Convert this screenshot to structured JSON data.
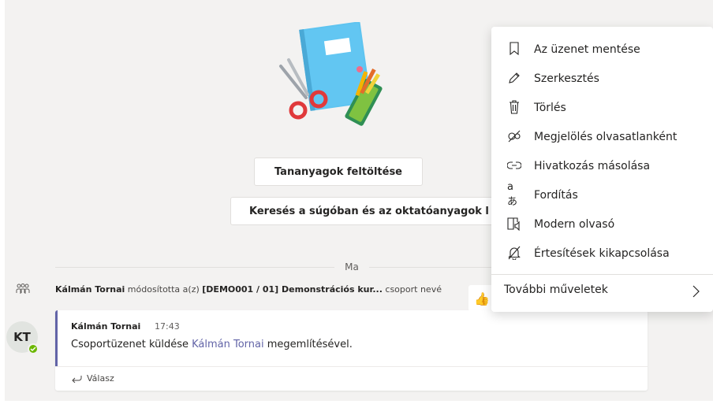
{
  "onboarding": {
    "upload_button": "Tananyagok feltöltése",
    "search_button": "Keresés a súgóban és az oktatóanyagok l"
  },
  "feed": {
    "date_divider": "Ma",
    "system_message": {
      "actor": "Kálmán Tornai",
      "text": " módosította a(z) ",
      "target": "[DEMO001 / 01] Demonstrációs kur...",
      "suffix": " csoport nevé"
    },
    "message": {
      "avatar_initials": "KT",
      "author": "Kálmán Tornai",
      "time": "17:43",
      "body_prefix": "Csoportüzenet küldése ",
      "mention": "Kálmán Tornai",
      "body_suffix": " megemlítésével.",
      "reply_label": "Válasz"
    },
    "reaction_emoji": "👍"
  },
  "context_menu": {
    "items": [
      {
        "label": "Az üzenet mentése",
        "icon": "bookmark-icon"
      },
      {
        "label": "Szerkesztés",
        "icon": "pencil-icon"
      },
      {
        "label": "Törlés",
        "icon": "trash-icon"
      },
      {
        "label": "Megjelölés olvasatlanként",
        "icon": "unread-icon"
      },
      {
        "label": "Hivatkozás másolása",
        "icon": "link-icon"
      },
      {
        "label": "Fordítás",
        "icon": "translate-icon"
      },
      {
        "label": "Modern olvasó",
        "icon": "immersive-reader-icon"
      },
      {
        "label": "Értesítések kikapcsolása",
        "icon": "bell-off-icon"
      }
    ],
    "more_actions": "További műveletek",
    "translate_glyph": "aあ"
  },
  "colors": {
    "accent": "#6264a7",
    "background": "#f3f2f1",
    "presence": "#6bb700"
  }
}
